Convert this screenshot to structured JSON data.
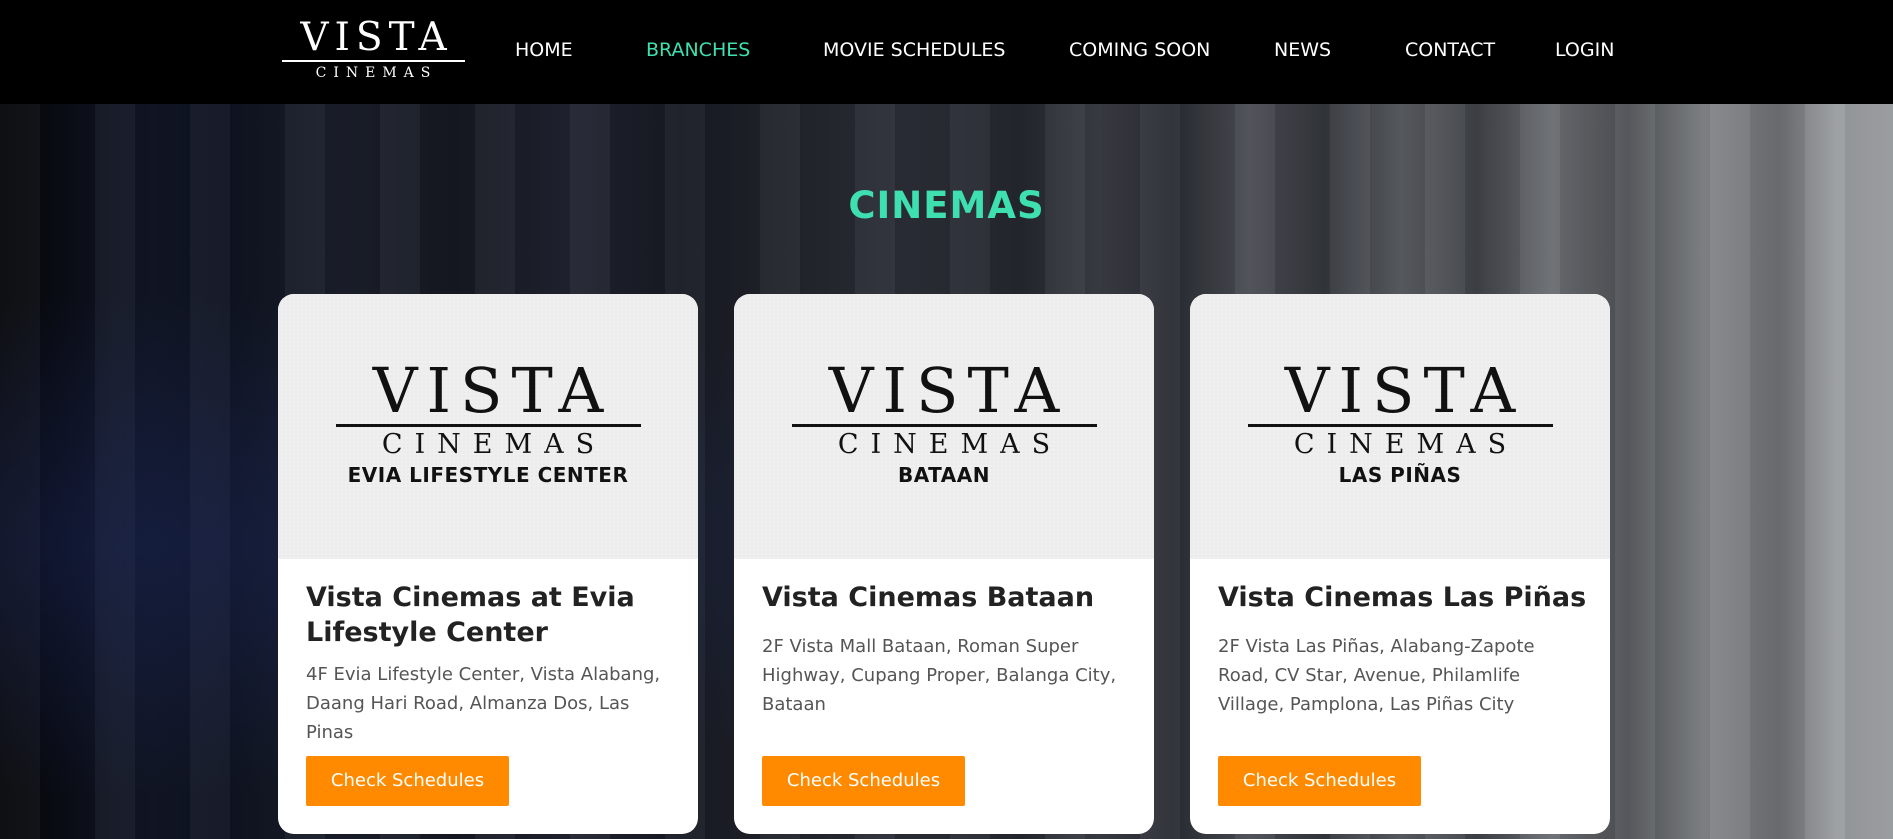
{
  "brand": {
    "top": "VISTA",
    "bottom": "CINEMAS"
  },
  "nav": [
    {
      "label": "HOME",
      "active": false
    },
    {
      "label": "BRANCHES",
      "active": true
    },
    {
      "label": "MOVIE SCHEDULES",
      "active": false
    },
    {
      "label": "COMING SOON",
      "active": false
    },
    {
      "label": "NEWS",
      "active": false
    },
    {
      "label": "CONTACT",
      "active": false
    },
    {
      "label": "LOGIN",
      "active": false
    }
  ],
  "section_title": "CINEMAS",
  "cards": [
    {
      "logo_top": "VISTA",
      "logo_mid": "CINEMAS",
      "logo_sub": "EVIA LIFESTYLE CENTER",
      "title": "Vista Cinemas at Evia Lifestyle Center",
      "address": "4F Evia Lifestyle Center, Vista Alabang, Daang Hari Road, Almanza Dos, Las Pinas",
      "button": "Check Schedules"
    },
    {
      "logo_top": "VISTA",
      "logo_mid": "CINEMAS",
      "logo_sub": "BATAAN",
      "title": "Vista Cinemas Bataan",
      "address": "2F Vista Mall Bataan, Roman Super Highway, Cupang Proper, Balanga City, Bataan",
      "button": "Check Schedules"
    },
    {
      "logo_top": "VISTA",
      "logo_mid": "CINEMAS",
      "logo_sub": "LAS PIÑAS",
      "title": "Vista Cinemas Las Piñas",
      "address": "2F Vista Las Piñas, Alabang-Zapote Road, CV Star, Avenue, Philamlife Village, Pamplona, Las Piñas City",
      "button": "Check Schedules"
    }
  ],
  "colors": {
    "accent": "#3fe0b0",
    "button": "#ff8a00",
    "nav_bg": "#000000"
  }
}
